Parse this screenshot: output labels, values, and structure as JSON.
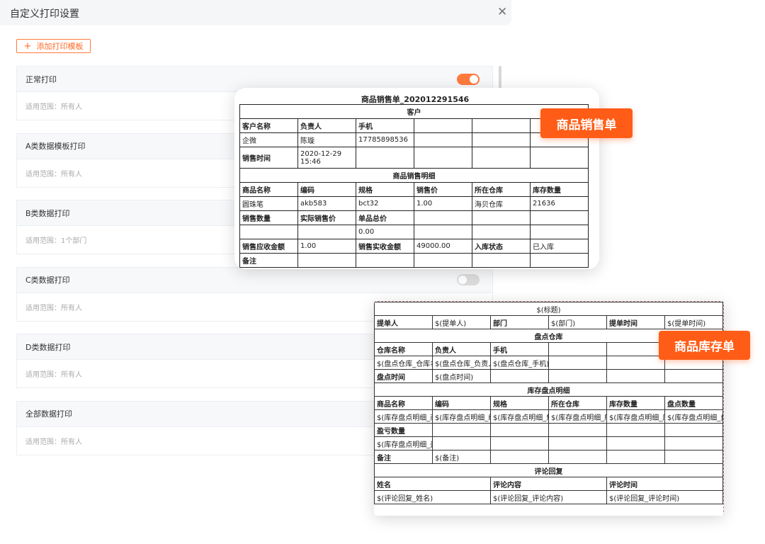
{
  "dialog": {
    "title": "自定义打印设置",
    "close_icon": "close-icon",
    "add_button_label": "添加打印模板"
  },
  "templates": [
    {
      "name": "正常打印",
      "scope": "适用范围：所有人",
      "enabled": true
    },
    {
      "name": "A类数据模板打印",
      "scope": "适用范围：所有人",
      "enabled": false
    },
    {
      "name": "B类数据打印",
      "scope": "适用范围：1个部门",
      "enabled": false
    },
    {
      "name": "C类数据打印",
      "scope": "适用范围：所有人",
      "enabled": false
    },
    {
      "name": "D类数据打印",
      "scope": "适用范围：所有人",
      "enabled": false
    },
    {
      "name": "全部数据打印",
      "scope": "适用范围：所有人",
      "enabled": false
    }
  ],
  "sales_preview": {
    "badge": "商品销售单",
    "title": "商品销售单_202012291546",
    "section_customer": "客户",
    "h_customer_name": "客户名称",
    "h_owner": "负责人",
    "h_phone": "手机",
    "customer_name": "企微",
    "owner": "陈璇",
    "phone": "17785898536",
    "h_sale_time": "销售时间",
    "sale_time": "2020-12-29 15:46",
    "section_detail": "商品销售明细",
    "h_product": "商品名称",
    "h_code": "编码",
    "h_spec": "规格",
    "h_price": "销售价",
    "h_warehouse": "所在仓库",
    "h_stock": "库存数量",
    "product": "圆珠笔",
    "code": "akb583",
    "spec": "bct32",
    "price": "1.00",
    "warehouse": "海贝仓库",
    "stock": "21636",
    "h_sale_qty": "销售数量",
    "h_actual_price": "实际销售价",
    "h_total": "单品总价",
    "total": "0.00",
    "h_receivable": "销售应收金额",
    "receivable": "1.00",
    "h_received": "销售实收金额",
    "received": "49000.00",
    "h_in_status": "入库状态",
    "in_status": "已入库",
    "h_remark": "备注"
  },
  "stock_preview": {
    "badge": "商品库存单",
    "title": "$(标题)",
    "h_submitter": "提单人",
    "submitter": "$(提单人)",
    "h_dept": "部门",
    "dept": "$(部门)",
    "h_submit_time": "提单时间",
    "submit_time": "$(提单时间)",
    "section_warehouse": "盘点仓库",
    "h_wh_name": "仓库名称",
    "h_owner": "负责人",
    "h_phone": "手机",
    "wh_name": "$(盘点仓库_仓库名称)",
    "wh_owner": "$(盘点仓库_负责人)",
    "wh_phone": "$(盘点仓库_手机)",
    "h_check_time": "盘点时间",
    "check_time": "$(盘点时间)",
    "section_detail": "库存盘点明细",
    "h_product": "商品名称",
    "h_code": "编码",
    "h_spec": "规格",
    "h_warehouse": "所在仓库",
    "h_stock": "库存数量",
    "h_check_qty": "盘点数量",
    "d_product": "$(库存盘点明细_商品名称)",
    "d_code": "$(库存盘点明细_编码)",
    "d_spec": "$(库存盘点明细_规格)",
    "d_warehouse": "$(库存盘点明细_所在仓库)",
    "d_stock": "$(库存盘点明细_库存数量)",
    "d_check_qty": "$(库存盘点明细_盘点数量)",
    "h_diff": "盈亏数量",
    "d_diff": "$(库存盘点明细_盈亏数量)",
    "h_remark": "备注",
    "remark": "$(备注)",
    "section_comment": "评论回复",
    "h_name": "姓名",
    "h_content": "评论内容",
    "h_time": "评论时间",
    "c_name": "$(评论回复_姓名)",
    "c_content": "$(评论回复_评论内容)",
    "c_time": "$(评论回复_评论时间)"
  }
}
